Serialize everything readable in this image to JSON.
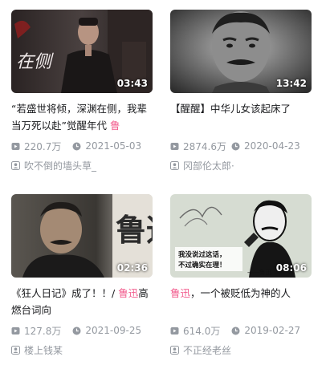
{
  "videos": [
    {
      "title_pre": "“若盛世将倾，深渊在侧，我辈当万死以赴”觉醒年代 ",
      "title_hl": "鲁",
      "title_post": "",
      "duration": "03:43",
      "views": "220.7万",
      "date": "2021-05-03",
      "author": "吹不倒的墙头草_"
    },
    {
      "title_pre": "【醒醒】中华儿女该起床了",
      "title_hl": "",
      "title_post": "",
      "duration": "13:42",
      "views": "2874.6万",
      "date": "2020-04-23",
      "author": "冈部伦太郎·"
    },
    {
      "title_pre": "《狂人日记》成了！！/ ",
      "title_hl": "鲁迅",
      "title_post": "高燃台词向",
      "duration": "02:36",
      "views": "127.8万",
      "date": "2021-09-25",
      "author": "楼上钱某"
    },
    {
      "title_pre": "",
      "title_hl": "鲁迅",
      "title_post": "，一个被贬低为神的人",
      "duration": "08:06",
      "views": "614.0万",
      "date": "2019-02-27",
      "author": "不正经老丝"
    }
  ],
  "thumb_text": {
    "t0_calligraphy": "在侧",
    "t2_calligraphy": "鲁迅",
    "t3_caption_l1": "我没说过这话，",
    "t3_caption_l2": "不过确实在理！",
    "t3_signature": "——鲁迅"
  },
  "icons": {
    "views": "play-count-icon",
    "date": "clock-icon",
    "author": "uploader-icon"
  },
  "colors": {
    "highlight": "#f25d8e",
    "meta": "#9499a0",
    "title": "#18191c"
  }
}
